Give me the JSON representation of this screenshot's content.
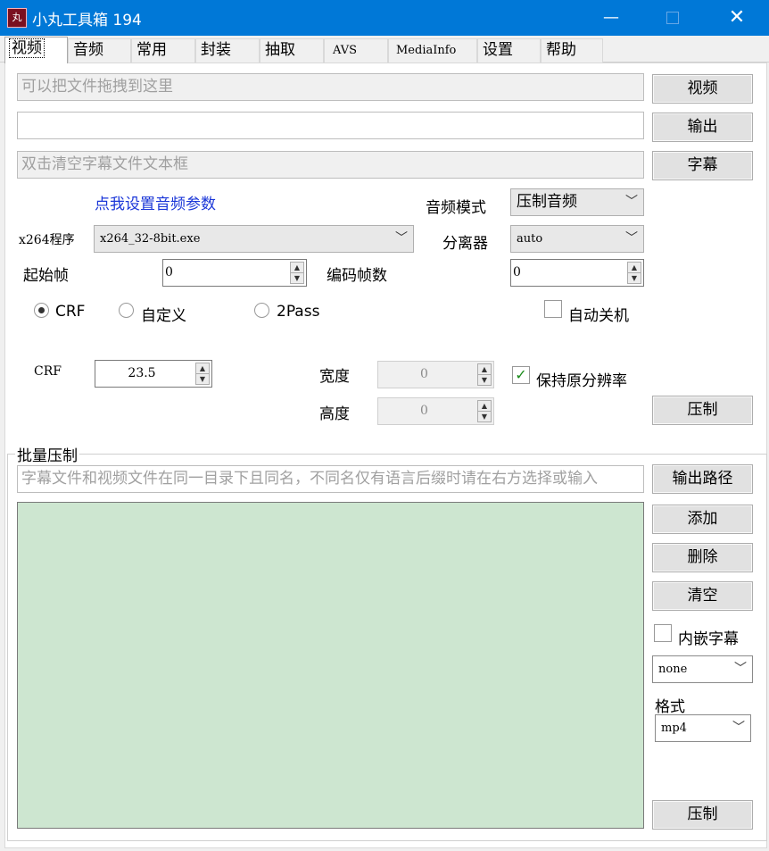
{
  "window": {
    "title": "小丸工具箱 194",
    "icon_text": "丸",
    "minimize": "—",
    "close": "✕"
  },
  "tabs": [
    {
      "label": "视频"
    },
    {
      "label": "音频"
    },
    {
      "label": "常用"
    },
    {
      "label": "封装"
    },
    {
      "label": "抽取"
    },
    {
      "label": "AVS"
    },
    {
      "label": "MediaInfo"
    },
    {
      "label": "设置"
    },
    {
      "label": "帮助"
    }
  ],
  "inputs": {
    "video_placeholder": "可以把文件拖拽到这里",
    "output_value": "",
    "subtitle_placeholder": "双击清空字幕文件文本框"
  },
  "buttons": {
    "video": "视频",
    "output": "输出",
    "subtitle": "字幕",
    "encode": "压制",
    "output_path": "输出路径",
    "add": "添加",
    "delete": "删除",
    "clear": "清空",
    "batch_encode": "压制"
  },
  "audio": {
    "link": "点我设置音频参数",
    "mode_label": "音频模式",
    "mode_value": "压制音频"
  },
  "x264": {
    "label": "x264程序",
    "value": "x264_32-8bit.exe"
  },
  "demuxer": {
    "label": "分离器",
    "value": "auto"
  },
  "frames": {
    "start_label": "起始帧",
    "start_value": "0",
    "count_label": "编码帧数",
    "count_value": "0"
  },
  "mode": {
    "crf": "CRF",
    "custom": "自定义",
    "twopass": "2Pass",
    "selected": "crf"
  },
  "auto_shutdown": {
    "label": "自动关机",
    "checked": false
  },
  "crf": {
    "label": "CRF",
    "value": "23.5"
  },
  "size": {
    "width_label": "宽度",
    "width_value": "0",
    "height_label": "高度",
    "height_value": "0"
  },
  "keep_res": {
    "label": "保持原分辨率",
    "checked": true
  },
  "batch": {
    "title": "批量压制",
    "hint": "字幕文件和视频文件在同一目录下且同名，不同名仅有语言后缀时请在右方选择或输入",
    "embed_sub_label": "内嵌字幕",
    "embed_sub_checked": false,
    "lang_value": "none",
    "format_label": "格式",
    "format_value": "mp4"
  },
  "icons": {
    "chevron": "﹀",
    "check": "✓"
  }
}
